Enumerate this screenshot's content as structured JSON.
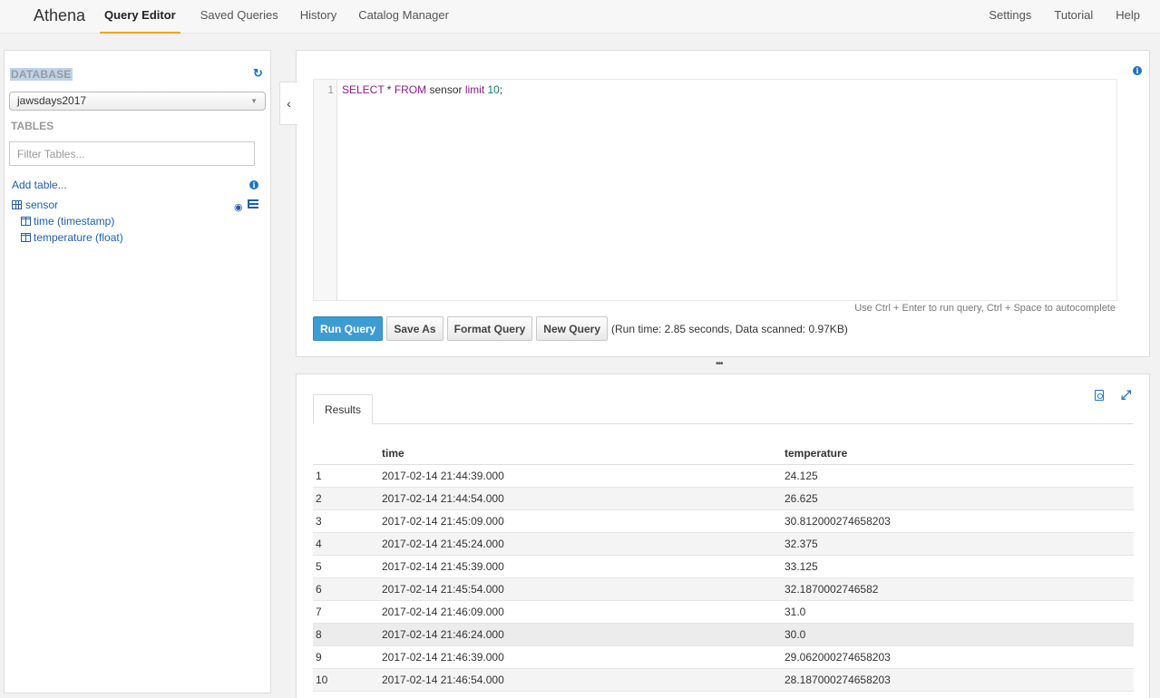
{
  "nav": {
    "brand": "Athena",
    "left": [
      "Query Editor",
      "Saved Queries",
      "History",
      "Catalog Manager"
    ],
    "right": [
      "Settings",
      "Tutorial",
      "Help"
    ],
    "active": "Query Editor"
  },
  "sidebar": {
    "database_label": "DATABASE",
    "database_selected": "jawsdays2017",
    "tables_label": "TABLES",
    "filter_placeholder": "Filter Tables...",
    "add_table": "Add table...",
    "table": {
      "name": "sensor",
      "columns": [
        "time (timestamp)",
        "temperature (float)"
      ]
    }
  },
  "editor": {
    "line_number": "1",
    "tokens": {
      "k1": "SELECT",
      "t1": " * ",
      "k2": "FROM",
      "t2": " sensor ",
      "k3": "limit",
      "t3": " ",
      "n1": "10",
      "t4": ";"
    },
    "hint": "Use Ctrl + Enter to run query, Ctrl + Space to autocomplete",
    "buttons": {
      "run": "Run Query",
      "save_as": "Save As",
      "format": "Format Query",
      "new": "New Query"
    },
    "run_info": "(Run time: 2.85 seconds, Data scanned: 0.97KB)"
  },
  "results": {
    "tab_label": "Results",
    "headers": [
      "",
      "time",
      "temperature"
    ],
    "rows": [
      [
        "1",
        "2017-02-14 21:44:39.000",
        "24.125"
      ],
      [
        "2",
        "2017-02-14 21:44:54.000",
        "26.625"
      ],
      [
        "3",
        "2017-02-14 21:45:09.000",
        "30.812000274658203"
      ],
      [
        "4",
        "2017-02-14 21:45:24.000",
        "32.375"
      ],
      [
        "5",
        "2017-02-14 21:45:39.000",
        "33.125"
      ],
      [
        "6",
        "2017-02-14 21:45:54.000",
        "32.1870002746582"
      ],
      [
        "7",
        "2017-02-14 21:46:09.000",
        "31.0"
      ],
      [
        "8",
        "2017-02-14 21:46:24.000",
        "30.0"
      ],
      [
        "9",
        "2017-02-14 21:46:39.000",
        "29.062000274658203"
      ],
      [
        "10",
        "2017-02-14 21:46:54.000",
        "28.187000274658203"
      ]
    ]
  },
  "icons": {
    "refresh": "refresh-icon",
    "info": "info-icon",
    "table": "table-grid-icon",
    "column": "column-icon",
    "preview": "eye-icon",
    "properties": "list-icon",
    "collapse": "chevron-left-icon",
    "download": "pdf-download-icon",
    "expand": "expand-icon"
  },
  "colors": {
    "accent_blue": "#1a73c6",
    "run_button": "#3d9cd2",
    "active_tab_underline": "#f0a500",
    "keyword": "#8a1a8a"
  }
}
